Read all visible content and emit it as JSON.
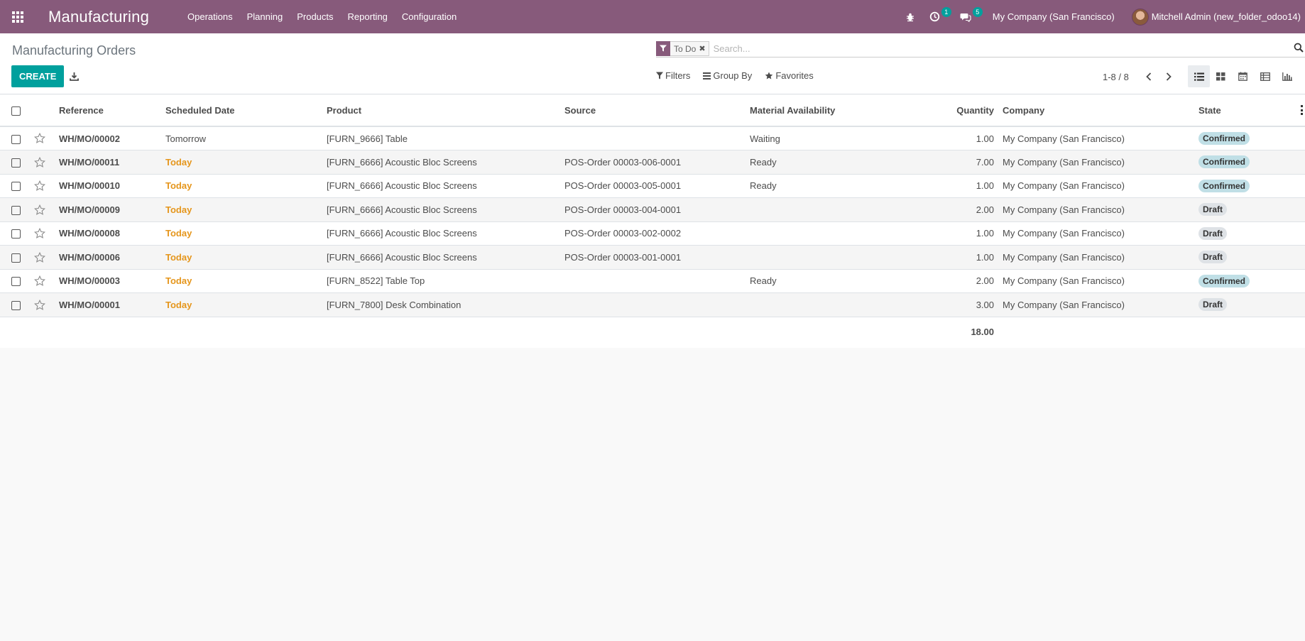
{
  "navbar": {
    "brand": "Manufacturing",
    "menu": [
      "Operations",
      "Planning",
      "Products",
      "Reporting",
      "Configuration"
    ],
    "activity_count": "1",
    "messages_count": "5",
    "company": "My Company (San Francisco)",
    "user": "Mitchell Admin (new_folder_odoo14)",
    "bg_color": "#875a7b"
  },
  "control_panel": {
    "title": "Manufacturing Orders",
    "create_label": "CREATE",
    "search": {
      "facet_label": "To Do",
      "placeholder": "Search..."
    },
    "filters_label": "Filters",
    "groupby_label": "Group By",
    "favorites_label": "Favorites",
    "pager": "1-8 / 8",
    "views": [
      "list-icon",
      "kanban-icon",
      "calendar-icon",
      "pivot-icon",
      "graph-icon"
    ]
  },
  "table": {
    "columns": {
      "reference": "Reference",
      "scheduled_date": "Scheduled Date",
      "product": "Product",
      "source": "Source",
      "material_availability": "Material Availability",
      "quantity": "Quantity",
      "company": "Company",
      "state": "State"
    },
    "rows": [
      {
        "reference": "WH/MO/00002",
        "scheduled_date": "Tomorrow",
        "date_is_today": false,
        "product": "[FURN_9666] Table",
        "source": "",
        "material_availability": "Waiting",
        "quantity": "1.00",
        "company": "My Company (San Francisco)",
        "state": "Confirmed"
      },
      {
        "reference": "WH/MO/00011",
        "scheduled_date": "Today",
        "date_is_today": true,
        "product": "[FURN_6666] Acoustic Bloc Screens",
        "source": "POS-Order 00003-006-0001",
        "material_availability": "Ready",
        "quantity": "7.00",
        "company": "My Company (San Francisco)",
        "state": "Confirmed"
      },
      {
        "reference": "WH/MO/00010",
        "scheduled_date": "Today",
        "date_is_today": true,
        "product": "[FURN_6666] Acoustic Bloc Screens",
        "source": "POS-Order 00003-005-0001",
        "material_availability": "Ready",
        "quantity": "1.00",
        "company": "My Company (San Francisco)",
        "state": "Confirmed"
      },
      {
        "reference": "WH/MO/00009",
        "scheduled_date": "Today",
        "date_is_today": true,
        "product": "[FURN_6666] Acoustic Bloc Screens",
        "source": "POS-Order 00003-004-0001",
        "material_availability": "",
        "quantity": "2.00",
        "company": "My Company (San Francisco)",
        "state": "Draft"
      },
      {
        "reference": "WH/MO/00008",
        "scheduled_date": "Today",
        "date_is_today": true,
        "product": "[FURN_6666] Acoustic Bloc Screens",
        "source": "POS-Order 00003-002-0002",
        "material_availability": "",
        "quantity": "1.00",
        "company": "My Company (San Francisco)",
        "state": "Draft"
      },
      {
        "reference": "WH/MO/00006",
        "scheduled_date": "Today",
        "date_is_today": true,
        "product": "[FURN_6666] Acoustic Bloc Screens",
        "source": "POS-Order 00003-001-0001",
        "material_availability": "",
        "quantity": "1.00",
        "company": "My Company (San Francisco)",
        "state": "Draft"
      },
      {
        "reference": "WH/MO/00003",
        "scheduled_date": "Today",
        "date_is_today": true,
        "product": "[FURN_8522] Table Top",
        "source": "",
        "material_availability": "Ready",
        "quantity": "2.00",
        "company": "My Company (San Francisco)",
        "state": "Confirmed"
      },
      {
        "reference": "WH/MO/00001",
        "scheduled_date": "Today",
        "date_is_today": true,
        "product": "[FURN_7800] Desk Combination",
        "source": "",
        "material_availability": "",
        "quantity": "3.00",
        "company": "My Company (San Francisco)",
        "state": "Draft"
      }
    ],
    "total_quantity": "18.00"
  },
  "colors": {
    "accent": "#00a09d",
    "today": "#e5961c",
    "confirmed_badge": "#c0dfe6",
    "draft_badge": "#dee2e6"
  }
}
